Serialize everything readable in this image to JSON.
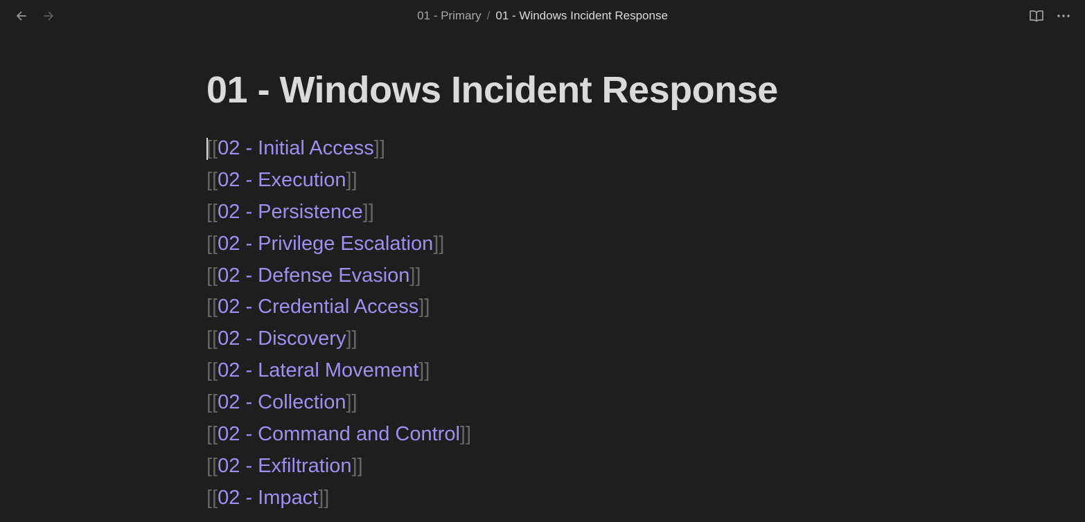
{
  "topbar": {
    "back_icon": "arrow-left-icon",
    "forward_icon": "arrow-right-icon",
    "breadcrumb": {
      "parent": "01 - Primary",
      "separator": "/",
      "current": "01 - Windows Incident Response"
    },
    "reading_view_icon": "book-open-icon",
    "more_icon": "more-horizontal-icon"
  },
  "document": {
    "title": "01 - Windows Incident Response",
    "bracket_open": "[[",
    "bracket_close": "]]",
    "links": [
      "02 - Initial Access",
      "02 - Execution",
      "02 - Persistence",
      "02 - Privilege Escalation",
      "02 - Defense Evasion",
      "02 - Credential Access",
      "02 - Discovery",
      "02 - Lateral Movement",
      "02 - Collection",
      "02 - Command and Control",
      "02 - Exfiltration",
      "02 - Impact"
    ]
  },
  "colors": {
    "background": "#1e1e1e",
    "title": "#dadada",
    "link": "#a08ff0",
    "bracket": "#666666"
  }
}
